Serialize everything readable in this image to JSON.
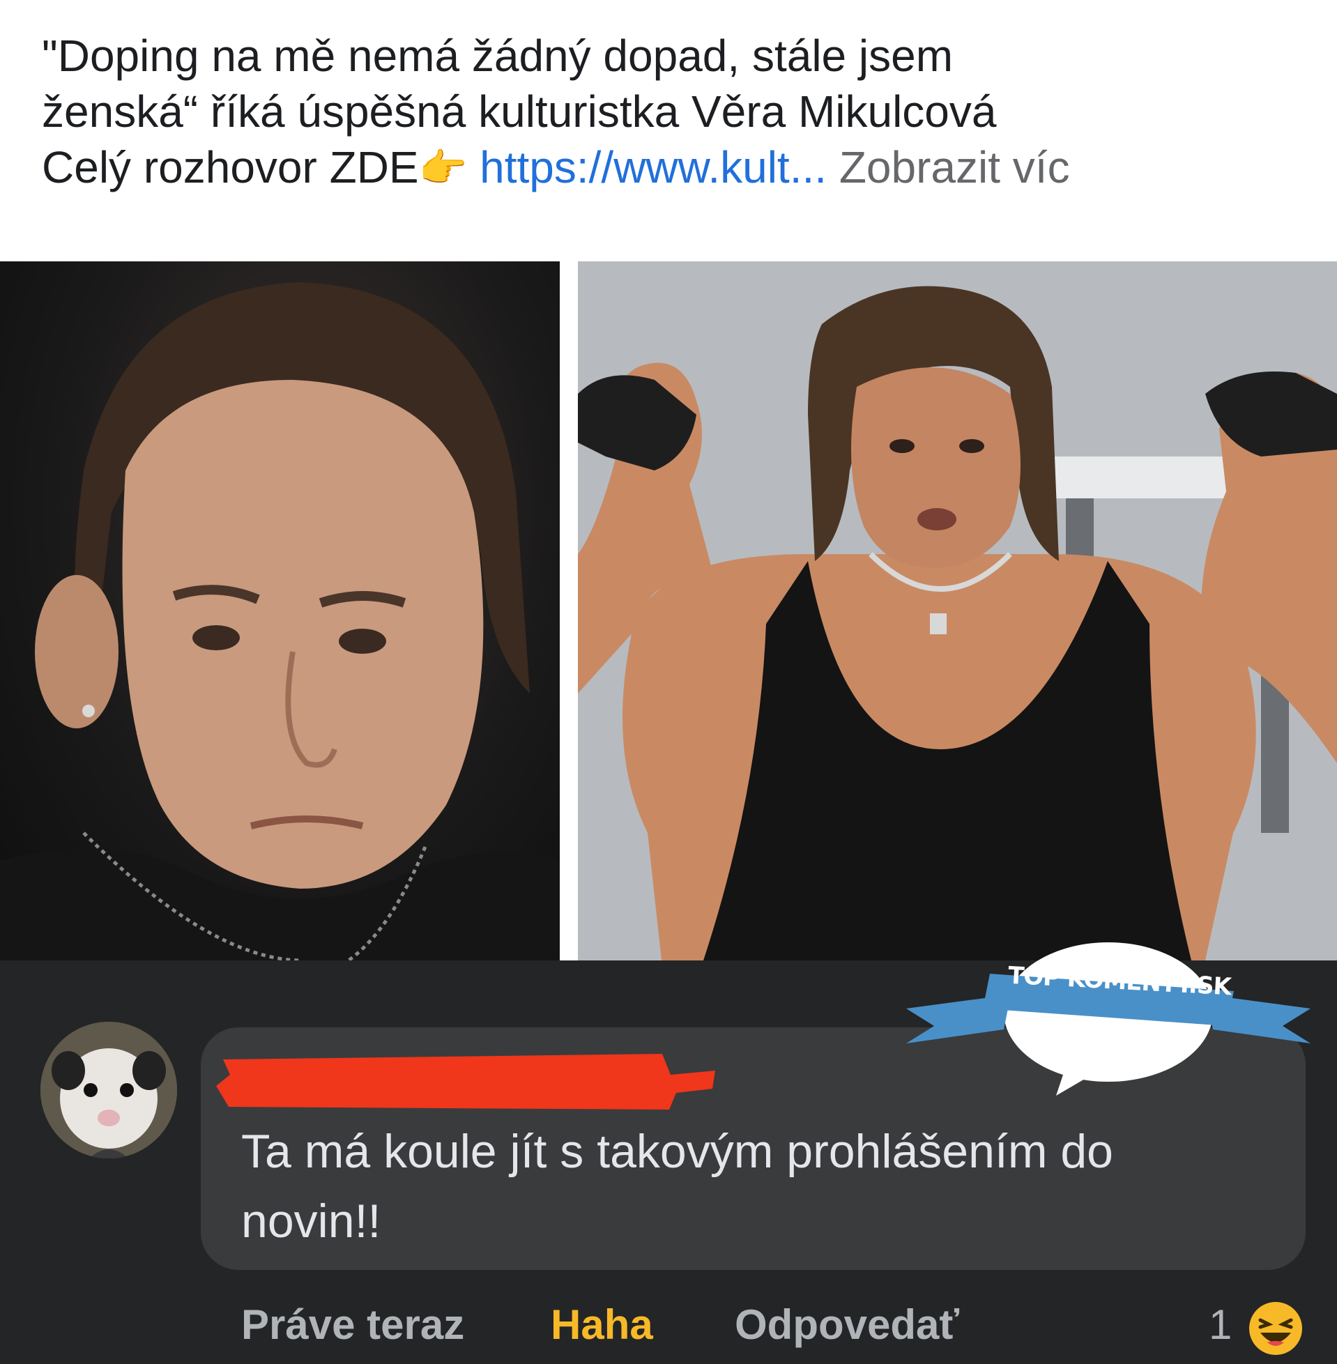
{
  "post": {
    "line1": "\"Doping na mě nemá žádný dopad, stále jsem",
    "line2": "ženská“ říká úspěšná kulturistka Věra Mikulcová",
    "line3_prefix": "Celý rozhovor ZDE",
    "line3_link": "https://www.kult...",
    "see_more": "Zobrazit víc",
    "pointing_emoji": "👉"
  },
  "images": {
    "left_icon": "photo-portrait",
    "right_icon": "photo-bodybuilder"
  },
  "watermark": {
    "text": "TOP KOMENTY.SK",
    "color": "#4a90c8"
  },
  "comment": {
    "avatar_icon": "opossum-avatar",
    "author_redacted_color": "#f0361b",
    "text_line1": "Ta má koule jít s takovým prohlášením do",
    "text_line2": "novin!!"
  },
  "actions": {
    "time": "Práve teraz",
    "haha": "Haha",
    "reply": "Odpovedať",
    "reaction_count": "1",
    "reaction_icon": "laughing-emoji"
  },
  "colors": {
    "link": "#216fdb",
    "haha_accent": "#f7b928",
    "dark_bg": "#242526",
    "bubble_bg": "#3a3b3c"
  }
}
